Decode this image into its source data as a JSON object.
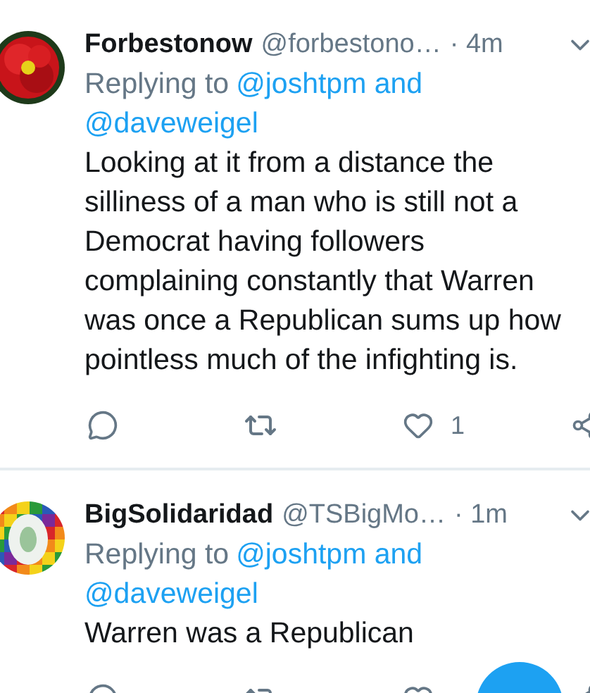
{
  "tweets": [
    {
      "name": "Forbestonow",
      "handle": "@forbestono…",
      "time": "· 4m",
      "reply_prefix": "Replying to",
      "reply_mentions": [
        "@joshtpm and",
        "@daveweigel"
      ],
      "body": "Looking at it from a distance the silliness of a man who is still not a Democrat having followers complaining constantly that Warren was once a Republican sums up how pointless much of the infighting is.",
      "likes": "1"
    },
    {
      "name": "BigSolidaridad",
      "handle": "@TSBigMo…",
      "time": "· 1m",
      "reply_prefix": "Replying to",
      "reply_mentions": [
        "@joshtpm and",
        "@daveweigel"
      ],
      "body": "Warren was a Republican"
    }
  ]
}
